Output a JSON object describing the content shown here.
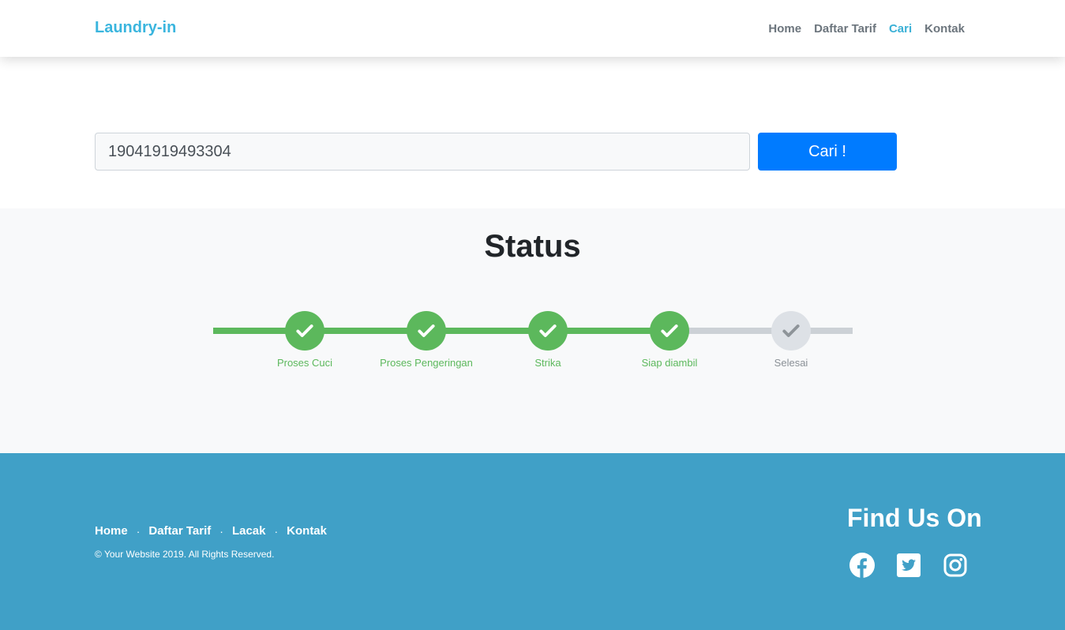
{
  "navbar": {
    "brand": "Laundry-in",
    "links": [
      {
        "label": "Home",
        "active": false
      },
      {
        "label": "Daftar Tarif",
        "active": false
      },
      {
        "label": "Cari",
        "active": true
      },
      {
        "label": "Kontak",
        "active": false
      }
    ]
  },
  "search": {
    "value": "19041919493304",
    "button_label": "Cari !"
  },
  "status": {
    "title": "Status",
    "steps": [
      {
        "label": "Proses Cuci",
        "done": true
      },
      {
        "label": "Proses Pengeringan",
        "done": true
      },
      {
        "label": "Strika",
        "done": true
      },
      {
        "label": "Siap diambil",
        "done": true
      },
      {
        "label": "Selesai",
        "done": false
      }
    ]
  },
  "footer": {
    "links": [
      "Home",
      "Daftar Tarif",
      "Lacak",
      "Kontak"
    ],
    "separator": "·",
    "copyright": "© Your Website 2019. All Rights Reserved.",
    "find_us": "Find Us On",
    "social_icons": [
      "facebook-icon",
      "twitter-icon",
      "instagram-icon"
    ]
  },
  "colors": {
    "brand": "#3ab5de",
    "primary_button": "#007bff",
    "success": "#5cb85c",
    "pending": "#dde1e6",
    "footer_bg": "#40a0c7"
  }
}
